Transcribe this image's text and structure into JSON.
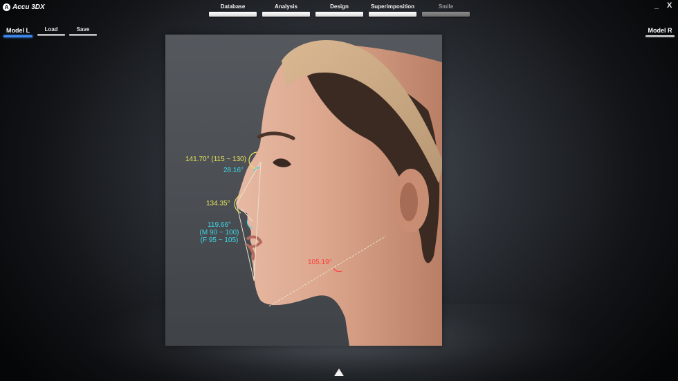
{
  "app": {
    "title": "Accu 3DX",
    "logo": "A"
  },
  "window": {
    "minimize": "_",
    "close": "X"
  },
  "tabs": [
    {
      "label": "Database",
      "enabled": true
    },
    {
      "label": "Analysis",
      "enabled": true
    },
    {
      "label": "Design",
      "enabled": true
    },
    {
      "label": "Superimposition",
      "enabled": true
    },
    {
      "label": "Smile",
      "enabled": false
    }
  ],
  "toolbar": {
    "model_l": "Model L",
    "load": "Load",
    "save": "Save",
    "model_r": "Model R"
  },
  "measurements": {
    "nasofrontal": {
      "value": "141.70°",
      "range": "(115 ~ 130)",
      "color": "#e8e45a"
    },
    "nasal_dorsum": {
      "value": "28.16°",
      "color": "#3fd6e6"
    },
    "nasal_tip": {
      "value": "134.35°",
      "color": "#e8e45a"
    },
    "nasolabial": {
      "value": "119.66°",
      "range_male": "(M 90 ~ 100)",
      "range_female": "(F 95 ~ 105)",
      "color": "#3fd6e6"
    },
    "mentocervical": {
      "value": "105.19°",
      "color": "#ff3a3a"
    }
  },
  "navigation": {
    "up_icon": "triangle-up-icon"
  }
}
